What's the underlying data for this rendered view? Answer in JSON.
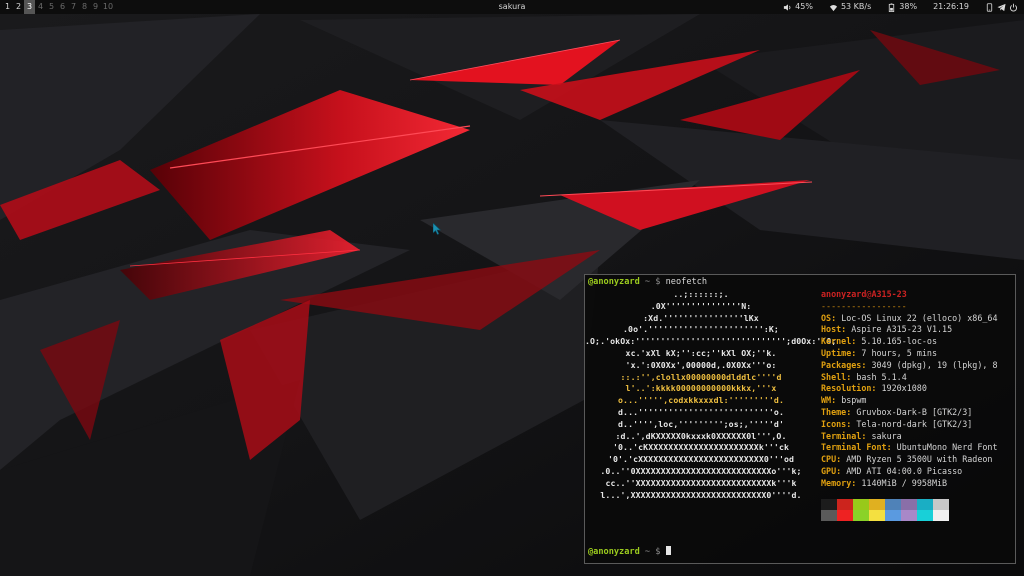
{
  "topbar": {
    "workspaces": [
      "1",
      "2",
      "3",
      "4",
      "5",
      "6",
      "7",
      "8",
      "9",
      "10"
    ],
    "active_workspace": "3",
    "window_title": "sakura",
    "volume": "45%",
    "network_speed": "53 KB/s",
    "battery": "38%",
    "clock": "21:26:19",
    "icons": [
      "volume-icon",
      "wifi-icon",
      "battery-icon",
      "phone-icon",
      "telegram-icon",
      "power-icon"
    ]
  },
  "terminal": {
    "prompt_user": "@anonyzard",
    "prompt_sep": " ~ $ ",
    "command": "neofetch",
    "ascii": [
      "..;::::::;.",
      ".0X'''''''''''''''N:",
      ":Xd.''''''''''''''''lKx",
      ".0o'.''''''''''''''''''''''':K;",
      ".O;.'okOx:'''''''''''''''''''''''''''''';d0Ox:''0;",
      "xc.'xXl kX;'':cc;''kXl OX;''k.",
      "'x.':0X0Xx',00000d,.0X0Xx'''o:",
      "::.:'',clollx00000000dlddlc''''d",
      "l'..':kkkk00000000000kkkx,'''x",
      "o...''''',codxkkxxxdl:'''''''''d.",
      "d...'''''''''''''''''''''''''''o.",
      "d..'''',loc,''''''''';os;,'''''d'",
      ":d..',dKXXXXX0kxxxk0XXXXXX0l''',O.",
      "'0..'cKXXXXXXXXXXXXXXXXXXXXXXk'''ck",
      "'0'.'cXXXXXXXXXXXXXXXXXXXXXXXXX0'''od",
      ".0..''0XXXXXXXXXXXXXXXXXXXXXXXXXXXo'''k;",
      "cc..''XXXXXXXXXXXXXXXXXXXXXXXXXXXk'''k",
      "l...',XXXXXXXXXXXXXXXXXXXXXXXXXXX0''''d."
    ],
    "ascii_highlight_rows": [
      7,
      8,
      9
    ],
    "header_user": "anonyzard",
    "header_at": "@",
    "header_host": "A315-23",
    "header_separator": "-----------------",
    "info": [
      {
        "key": "OS",
        "value": "Loc-OS Linux 22 (elloco) x86_64"
      },
      {
        "key": "Host",
        "value": "Aspire A315-23 V1.15"
      },
      {
        "key": "Kernel",
        "value": "5.10.165-loc-os"
      },
      {
        "key": "Uptime",
        "value": "7 hours, 5 mins"
      },
      {
        "key": "Packages",
        "value": "3049 (dpkg), 19 (lpkg), 8"
      },
      {
        "key": "Shell",
        "value": "bash 5.1.4"
      },
      {
        "key": "Resolution",
        "value": "1920x1080"
      },
      {
        "key": "WM",
        "value": "bspwm"
      },
      {
        "key": "Theme",
        "value": "Gruvbox-Dark-B [GTK2/3]"
      },
      {
        "key": "Icons",
        "value": "Tela-nord-dark [GTK2/3]"
      },
      {
        "key": "Terminal",
        "value": "sakura"
      },
      {
        "key": "Terminal Font",
        "value": "UbuntuMono Nerd Font"
      },
      {
        "key": "CPU",
        "value": "AMD Ryzen 5 3500U with Radeon"
      },
      {
        "key": "GPU",
        "value": "AMD ATI 04:00.0 Picasso"
      },
      {
        "key": "Memory",
        "value": "1140MiB / 9958MiB"
      }
    ],
    "palette": [
      "#1c1c1c",
      "#cc241d",
      "#98c91a",
      "#e0b020",
      "#4f82b8",
      "#8a6fa8",
      "#1aaec4",
      "#c8c8c8",
      "#5a5a5a",
      "#ee2222",
      "#8ad228",
      "#f4e040",
      "#5a9ae0",
      "#a888c8",
      "#18d0d8",
      "#f0f0f0"
    ],
    "second_prompt_user": "@anonyzard",
    "second_prompt_sep": " ~ $ "
  },
  "colors": {
    "accent_red": "#e0101e",
    "prompt_green": "#9ccc1e",
    "info_key_orange": "#e0a010"
  }
}
